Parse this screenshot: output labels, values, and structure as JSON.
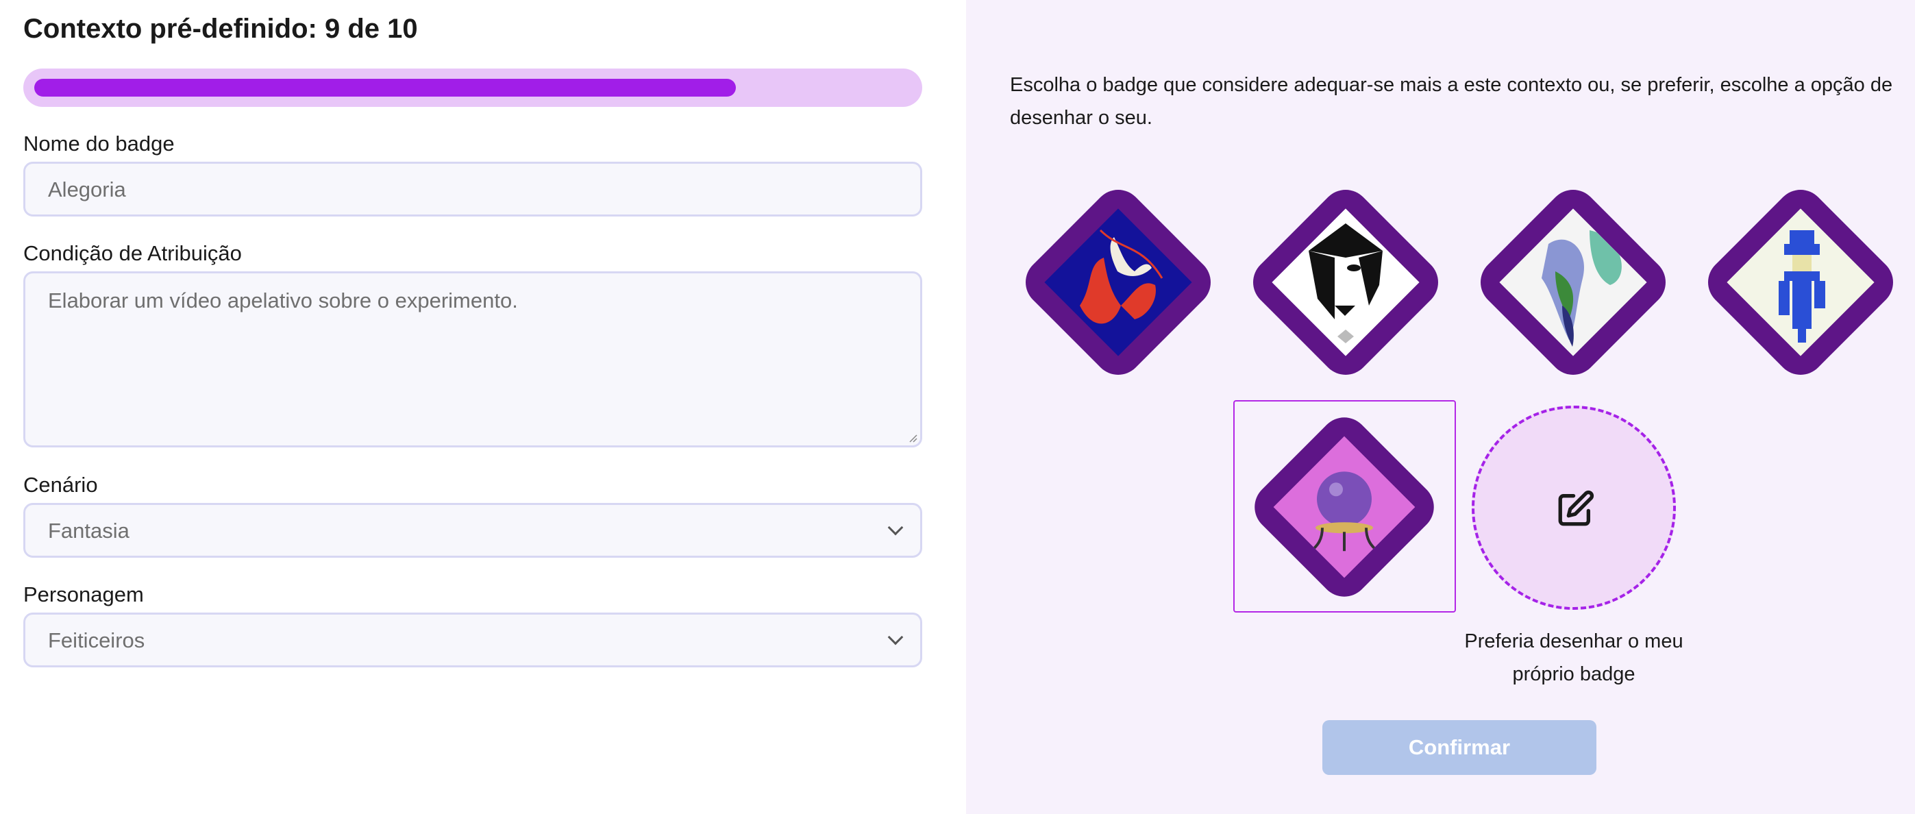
{
  "header": {
    "title": "Contexto pré-definido: 9 de 10"
  },
  "progress": {
    "value": 0.8
  },
  "form": {
    "name": {
      "label": "Nome do badge",
      "value": "Alegoria"
    },
    "condition": {
      "label": "Condição de Atribuição",
      "value": "Elaborar um vídeo apelativo sobre o experimento."
    },
    "scenario": {
      "label": "Cenário",
      "value": "Fantasia"
    },
    "character": {
      "label": "Personagem",
      "value": "Feiticeiros"
    }
  },
  "picker": {
    "description": "Escolha o badge que considere adequar-se mais a este contexto ou, se preferir, escolhe a opção de desenhar o seu.",
    "draw_option_label": "Preferia desenhar o meu próprio badge",
    "confirm_label": "Confirmar"
  },
  "colors": {
    "accent": "#a11ee8",
    "progress_track": "#e8c6f8",
    "badge_frame": "#5e1587",
    "confirm_disabled": "#b1c5ea",
    "right_panel_bg": "#f7f1fc"
  }
}
